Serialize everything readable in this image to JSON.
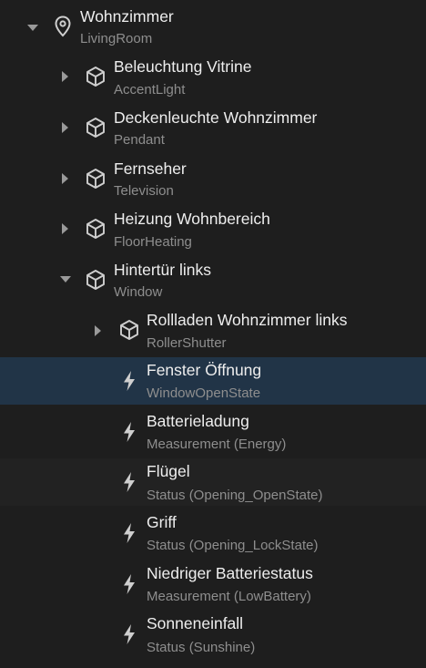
{
  "tree": {
    "root": {
      "label": "Wohnzimmer",
      "type": "LivingRoom",
      "icon": "location-pin-icon"
    },
    "equipment": [
      {
        "label": "Beleuchtung Vitrine",
        "type": "AccentLight",
        "icon": "cube-icon"
      },
      {
        "label": "Deckenleuchte Wohnzimmer",
        "type": "Pendant",
        "icon": "cube-icon"
      },
      {
        "label": "Fernseher",
        "type": "Television",
        "icon": "cube-icon"
      },
      {
        "label": "Heizung Wohnbereich",
        "type": "FloorHeating",
        "icon": "cube-icon"
      },
      {
        "label": "Hintertür links",
        "type": "Window",
        "icon": "cube-icon"
      }
    ],
    "sub_equipment": {
      "label": "Rollladen Wohnzimmer links",
      "type": "RollerShutter",
      "icon": "cube-icon"
    },
    "points": [
      {
        "label": "Fenster Öffnung",
        "type": "WindowOpenState",
        "icon": "bolt-icon"
      },
      {
        "label": "Batterieladung",
        "type": "Measurement (Energy)",
        "icon": "bolt-icon"
      },
      {
        "label": "Flügel",
        "type": "Status (Opening_OpenState)",
        "icon": "bolt-icon"
      },
      {
        "label": "Griff",
        "type": "Status (Opening_LockState)",
        "icon": "bolt-icon"
      },
      {
        "label": "Niedriger Batteriestatus",
        "type": "Measurement (LowBattery)",
        "icon": "bolt-icon"
      },
      {
        "label": "Sonneneinfall",
        "type": "Status (Sunshine)",
        "icon": "bolt-icon"
      }
    ]
  },
  "colors": {
    "background": "#1e1e1e",
    "selected_row": "#213447",
    "alt_row": "#222222",
    "text_primary": "#eeeeee",
    "text_secondary": "#8e8e8e",
    "icon": "#cfcfcf",
    "chevron": "#9a9a9a"
  }
}
